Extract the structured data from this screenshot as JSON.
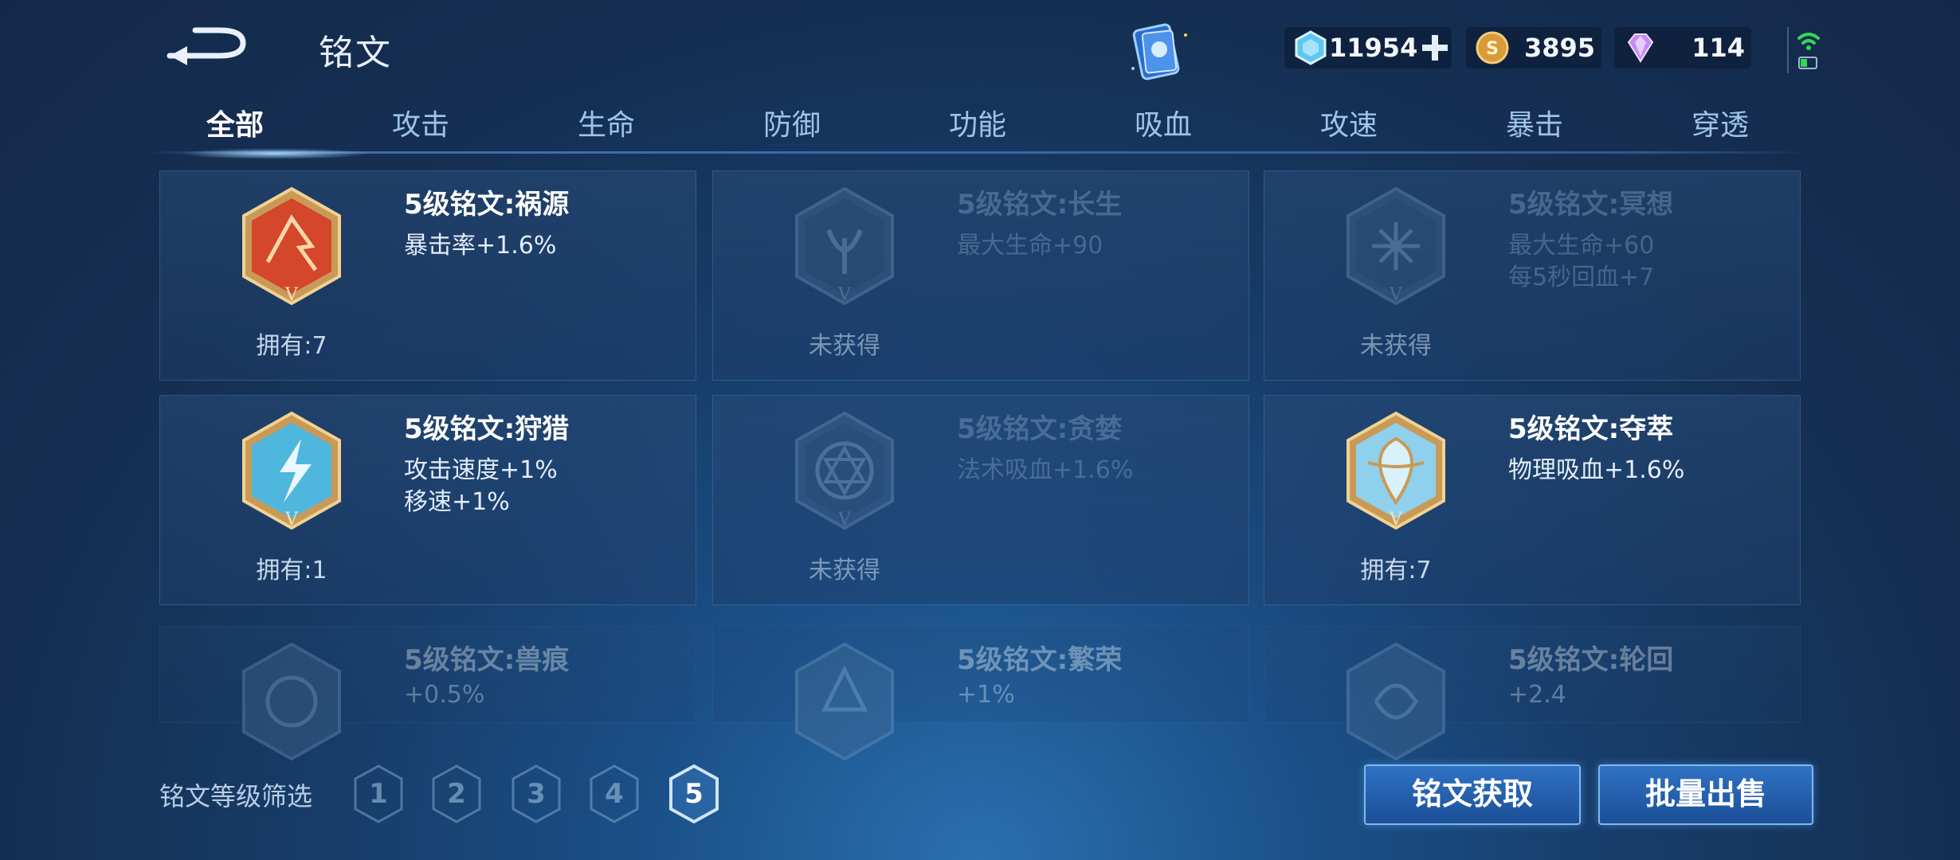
{
  "header": {
    "title": "铭文",
    "currencies": {
      "diamond": "11954",
      "gold": "3895",
      "gem": "114"
    }
  },
  "tabs": [
    {
      "label": "全部",
      "active": true
    },
    {
      "label": "攻击"
    },
    {
      "label": "生命"
    },
    {
      "label": "防御"
    },
    {
      "label": "功能"
    },
    {
      "label": "吸血"
    },
    {
      "label": "攻速"
    },
    {
      "label": "暴击"
    },
    {
      "label": "穿透"
    }
  ],
  "inscriptions": [
    {
      "name": "5级铭文:祸源",
      "effects": [
        "暴击率+1.6%"
      ],
      "owned": "拥有:7",
      "status": "owned",
      "color": "#d4472b"
    },
    {
      "name": "5级铭文:长生",
      "effects": [
        "最大生命+90"
      ],
      "owned": "未获得",
      "status": "locked"
    },
    {
      "name": "5级铭文:冥想",
      "effects": [
        "最大生命+60",
        "每5秒回血+7"
      ],
      "owned": "未获得",
      "status": "locked"
    },
    {
      "name": "5级铭文:狩猎",
      "effects": [
        "攻击速度+1%",
        "移速+1%"
      ],
      "owned": "拥有:1",
      "status": "owned",
      "color": "#4fb6dd"
    },
    {
      "name": "5级铭文:贪婪",
      "effects": [
        "法术吸血+1.6%"
      ],
      "owned": "未获得",
      "status": "locked"
    },
    {
      "name": "5级铭文:夺萃",
      "effects": [
        "物理吸血+1.6%"
      ],
      "owned": "拥有:7",
      "status": "owned",
      "color": "#8fd0ec"
    },
    {
      "name": "5级铭文:兽痕",
      "effects": [
        "+0.5%"
      ],
      "status": "partial"
    },
    {
      "name": "5级铭文:繁荣",
      "effects": [
        "+1%"
      ],
      "status": "partial"
    },
    {
      "name": "5级铭文:轮回",
      "effects": [
        "+2.4"
      ],
      "status": "partial"
    }
  ],
  "filter": {
    "label": "铭文等级筛选",
    "levels": [
      "1",
      "2",
      "3",
      "4",
      "5"
    ],
    "selected": "5"
  },
  "buttons": {
    "obtain": "铭文获取",
    "sell": "批量出售"
  },
  "colors": {
    "accent": "#2f72c4",
    "bronze": "#c99a57"
  }
}
